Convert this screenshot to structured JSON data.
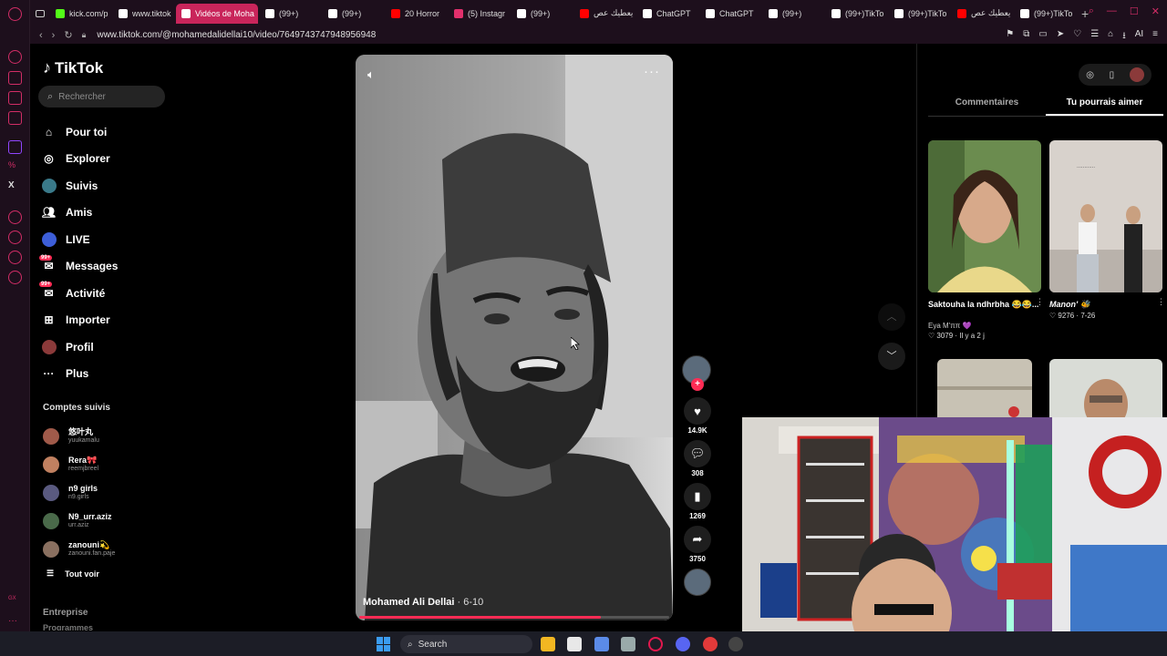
{
  "browser": {
    "tabs": [
      {
        "label": "kick.com/p",
        "color": "#53fc18",
        "active": false
      },
      {
        "label": "www.tiktok",
        "color": "#ffffff",
        "active": false
      },
      {
        "label": "Vidéos de Moha",
        "color": "#ffffff",
        "active": true
      },
      {
        "label": "(99+)",
        "color": "#ffffff",
        "active": false
      },
      {
        "label": "(99+)",
        "color": "#ffffff",
        "active": false
      },
      {
        "label": "20 Horror",
        "color": "#ff0000",
        "active": false
      },
      {
        "label": "(5) Instagr",
        "color": "#e1306c",
        "active": false
      },
      {
        "label": "(99+)",
        "color": "#ffffff",
        "active": false
      },
      {
        "label": "يعطيك عص",
        "color": "#ff0000",
        "active": false
      },
      {
        "label": "ChatGPT",
        "color": "#ffffff",
        "active": false
      },
      {
        "label": "ChatGPT",
        "color": "#ffffff",
        "active": false
      },
      {
        "label": "(99+)",
        "color": "#ffffff",
        "active": false
      },
      {
        "label": "(99+)TikTo",
        "color": "#ffffff",
        "active": false
      },
      {
        "label": "(99+)TikTo",
        "color": "#ffffff",
        "active": false
      },
      {
        "label": "يعطيك عص",
        "color": "#ff0000",
        "active": false
      },
      {
        "label": "(99+)TikTo",
        "color": "#ffffff",
        "active": false
      }
    ],
    "url": "www.tiktok.com/@mohamedalidellai10/video/7649743747948956948"
  },
  "sidebar": {
    "logo": "TikTok",
    "search_placeholder": "Rechercher",
    "nav": [
      {
        "label": "Pour toi",
        "icon": "home-icon"
      },
      {
        "label": "Explorer",
        "icon": "compass-icon"
      },
      {
        "label": "Suivis",
        "icon": "following-avatar-icon"
      },
      {
        "label": "Amis",
        "icon": "friends-icon"
      },
      {
        "label": "LIVE",
        "icon": "live-icon"
      },
      {
        "label": "Messages",
        "icon": "messages-icon",
        "badge": "99+"
      },
      {
        "label": "Activité",
        "icon": "activity-icon",
        "badge": "99+"
      },
      {
        "label": "Importer",
        "icon": "upload-icon"
      },
      {
        "label": "Profil",
        "icon": "profile-icon"
      },
      {
        "label": "Plus",
        "icon": "more-icon"
      }
    ],
    "following_title": "Comptes suivis",
    "following": [
      {
        "name": "悠叶丸",
        "handle": "yuukamalu",
        "color": "#a05a4a"
      },
      {
        "name": "Rera🎀",
        "handle": "reemjbreel",
        "color": "#c08060"
      },
      {
        "name": "n9 girls",
        "handle": "n9.girls",
        "color": "#5a5a80"
      },
      {
        "name": "N9_urr.aziz",
        "handle": "urr.aziz",
        "color": "#4a6a4a"
      },
      {
        "name": "zanouni💫",
        "handle": "zanouni.fan.paje",
        "color": "#8a7060"
      }
    ],
    "see_all": "Tout voir",
    "entreprise": "Entreprise",
    "programmes": "Programmes"
  },
  "video": {
    "author": "Mohamed Ali Dellai",
    "date": "6-10",
    "progress": 0.78,
    "likes": "14.9K",
    "comments": "308",
    "saves": "1269",
    "shares": "3750"
  },
  "right_panel": {
    "tabs": [
      "Commentaires",
      "Tu pourrais aimer"
    ],
    "active_tab": 1,
    "cards": [
      {
        "title": "Saktouha la ndhrbha 😂😂...",
        "author": "Eya M'ππ 💜",
        "likes": "3079",
        "age": "Il y a 2 j"
      },
      {
        "title": "Manon' 🐝",
        "author": "",
        "likes": "9276",
        "age": "7-26"
      },
      {
        "title": "",
        "author": "",
        "likes": "",
        "age": ""
      },
      {
        "title": "",
        "author": "",
        "likes": "",
        "age": ""
      }
    ]
  },
  "taskbar": {
    "search_label": "Search"
  }
}
